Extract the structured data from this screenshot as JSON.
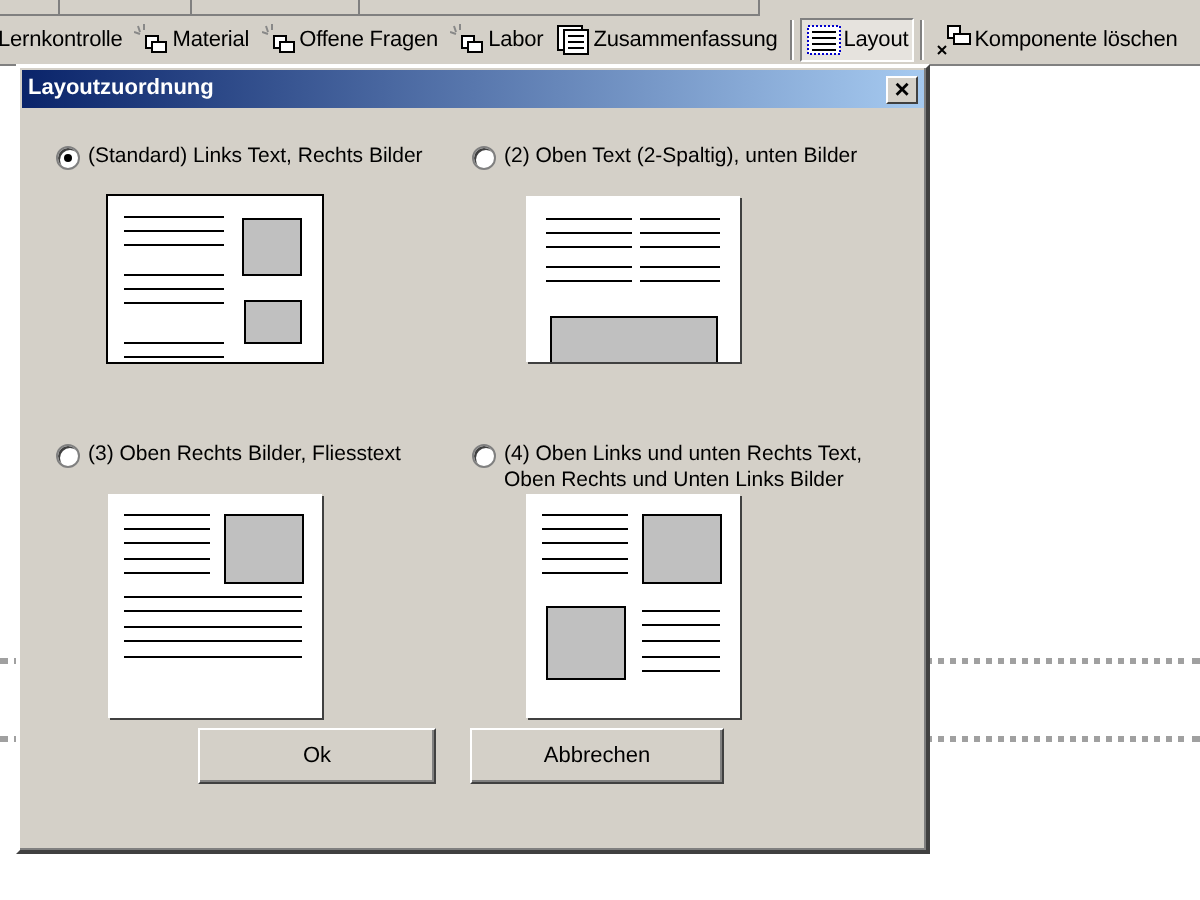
{
  "toolbar": {
    "items": [
      {
        "label": "Lernkontrolle",
        "kind": "plain",
        "pressed": false
      },
      {
        "label": "Material",
        "kind": "component",
        "pressed": false
      },
      {
        "label": "Offene Fragen",
        "kind": "component",
        "pressed": false
      },
      {
        "label": "Labor",
        "kind": "component",
        "pressed": false
      },
      {
        "label": "Zusammenfassung",
        "kind": "summary",
        "pressed": false
      },
      {
        "label": "Layout",
        "kind": "layout",
        "pressed": true
      },
      {
        "label": "Komponente löschen",
        "kind": "delete",
        "pressed": false
      }
    ]
  },
  "dialog": {
    "title": "Layoutzuordnung",
    "close": "×",
    "options": [
      {
        "label": "(Standard) Links Text, Rechts Bilder",
        "selected": true,
        "kind": "standard"
      },
      {
        "label": "(2) Oben Text (2-Spaltig), unten Bilder",
        "selected": false,
        "kind": "two-column"
      },
      {
        "label": "(3) Oben Rechts Bilder, Fliesstext",
        "selected": false,
        "kind": "top-right"
      },
      {
        "label": "(4) Oben Links und unten Rechts Text, Oben Rechts und Unten Links Bilder",
        "selected": false,
        "kind": "alternating"
      }
    ],
    "buttons": [
      "Ok",
      "Abbrechen"
    ]
  }
}
